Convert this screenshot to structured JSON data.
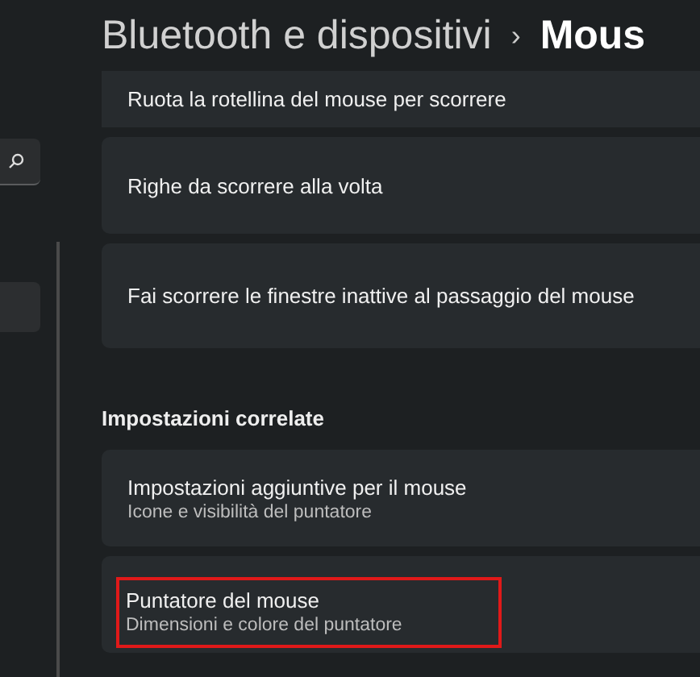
{
  "breadcrumb": {
    "parent": "Bluetooth e dispositivi",
    "separator": "›",
    "current": "Mous"
  },
  "sidebar": {
    "items": [
      {
        "selected": true
      }
    ]
  },
  "sections": [
    {
      "cards": [
        {
          "title": "Ruota la rotellina del mouse per scorrere",
          "highlighted": false
        },
        {
          "title": "Righe da scorrere alla volta",
          "highlighted": false
        },
        {
          "title": "Fai scorrere le finestre inattive al passaggio del mouse",
          "highlighted": false
        }
      ]
    },
    {
      "heading": "Impostazioni correlate",
      "cards": [
        {
          "title": "Impostazioni aggiuntive per il mouse",
          "subtitle": "Icone e visibilità del puntatore",
          "highlighted": false
        },
        {
          "title": "Puntatore del mouse",
          "subtitle": "Dimensioni e colore del puntatore",
          "highlighted": true
        }
      ]
    }
  ]
}
